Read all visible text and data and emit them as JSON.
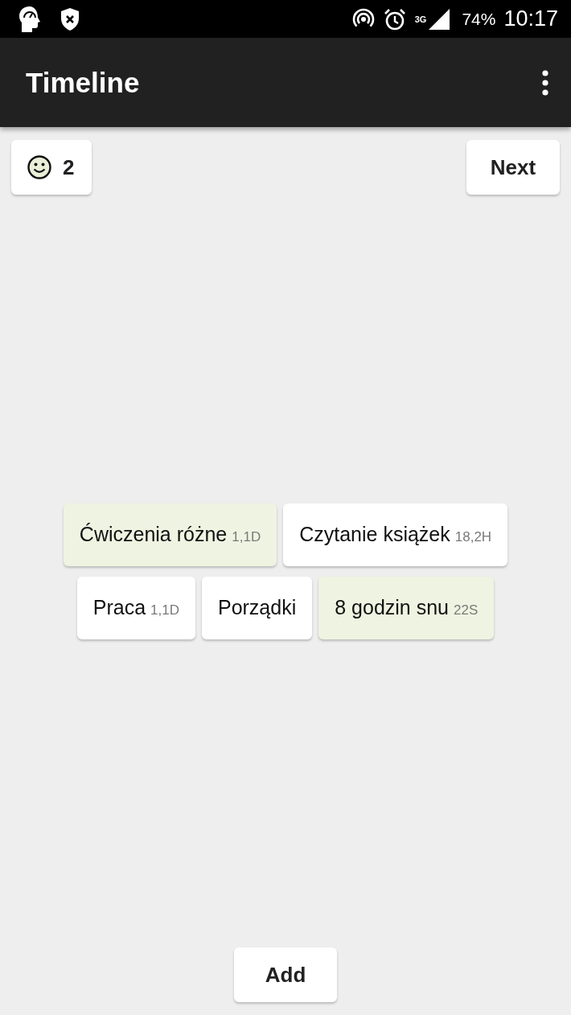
{
  "status_bar": {
    "network": "3G",
    "battery": "74%",
    "time": "10:17"
  },
  "app_bar": {
    "title": "Timeline"
  },
  "toolbar": {
    "mood_count": "2",
    "next_button": "Next"
  },
  "chip_rows": [
    [
      {
        "name": "Ćwiczenia różne",
        "duration": "1,1D",
        "highlighted": true
      },
      {
        "name": "Czytanie książek",
        "duration": "18,2H",
        "highlighted": false
      }
    ],
    [
      {
        "name": "Praca",
        "duration": "1,1D",
        "highlighted": false
      },
      {
        "name": "Porządki",
        "highlighted": false
      },
      {
        "name": "8 godzin snu",
        "duration": "22S",
        "highlighted": true
      }
    ]
  ],
  "add_button": "Add"
}
